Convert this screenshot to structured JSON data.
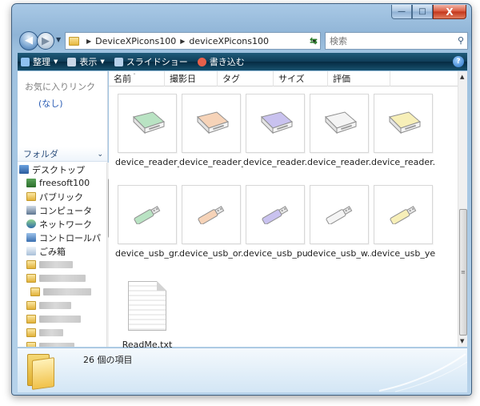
{
  "window": {
    "caption": {
      "minimize": "—",
      "maximize": "□",
      "close": "X"
    }
  },
  "address": {
    "segments": [
      "DeviceXPicons100",
      "deviceXPicons100"
    ],
    "search_placeholder": "検索"
  },
  "commands": [
    {
      "label": "整理",
      "has_menu": true,
      "icon": "organize-icon",
      "color": "#8fc2f0"
    },
    {
      "label": "表示",
      "has_menu": true,
      "icon": "views-icon",
      "color": "#c8d6e6"
    },
    {
      "label": "スライドショー",
      "has_menu": false,
      "icon": "slideshow-icon",
      "color": "#b5d0ea"
    },
    {
      "label": "書き込む",
      "has_menu": false,
      "icon": "burn-icon",
      "color": "#e7604b"
    }
  ],
  "nav": {
    "favorites_title": "お気に入りリンク",
    "favorites_empty": "(なし)",
    "folders_title": "フォルダ",
    "tree": [
      {
        "label": "デスクトップ",
        "icon": "desktop-icon",
        "indent": 0
      },
      {
        "label": "freesoft100",
        "icon": "freesoft-icon",
        "indent": 1
      },
      {
        "label": "パブリック",
        "icon": "folder-icon",
        "indent": 1
      },
      {
        "label": "コンピュータ",
        "icon": "computer-icon",
        "indent": 1
      },
      {
        "label": "ネットワーク",
        "icon": "network-icon",
        "indent": 1
      },
      {
        "label": "コントロールパ",
        "icon": "control-panel-icon",
        "indent": 1
      },
      {
        "label": "ごみ箱",
        "icon": "recycle-bin-icon",
        "indent": 1
      }
    ]
  },
  "columns": [
    "名前",
    "撮影日",
    "タグ",
    "サイズ",
    "評価"
  ],
  "files": [
    {
      "name": "device_reader_...",
      "kind": "reader",
      "tint": "#b9e3c3"
    },
    {
      "name": "device_reader_...",
      "kind": "reader",
      "tint": "#f6d3b8"
    },
    {
      "name": "device_reader...",
      "kind": "reader",
      "tint": "#c9c2ef"
    },
    {
      "name": "device_reader...",
      "kind": "reader",
      "tint": "#f4f4f4"
    },
    {
      "name": "device_reader...",
      "kind": "reader",
      "tint": "#f7efb8"
    },
    {
      "name": "device_usb_gr...",
      "kind": "usb",
      "tint": "#b9e3c3"
    },
    {
      "name": "device_usb_or...",
      "kind": "usb",
      "tint": "#f6d3b8"
    },
    {
      "name": "device_usb_pu...",
      "kind": "usb",
      "tint": "#c9c2ef"
    },
    {
      "name": "device_usb_w...",
      "kind": "usb",
      "tint": "#f4f4f4"
    },
    {
      "name": "device_usb_ye...",
      "kind": "usb",
      "tint": "#f7efb8"
    },
    {
      "name": "ReadMe.txt",
      "kind": "text",
      "tint": "#ffffff"
    }
  ],
  "status": {
    "item_count": "26 個の項目"
  }
}
